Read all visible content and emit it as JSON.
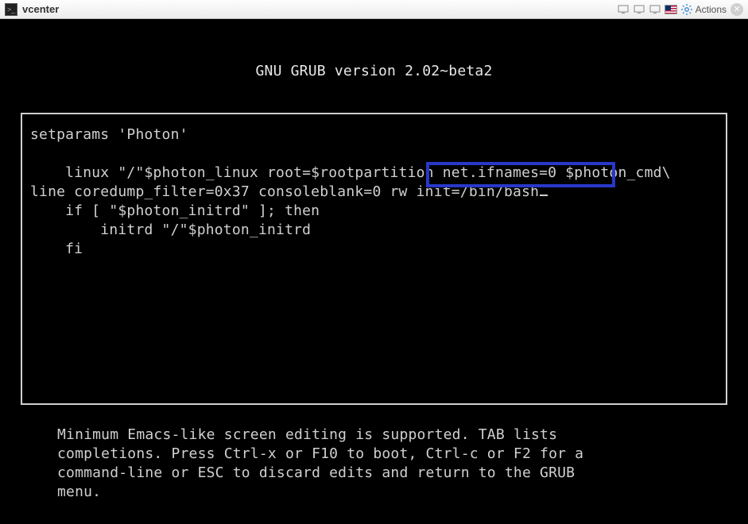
{
  "titlebar": {
    "title": "vcenter",
    "actions_label": "Actions"
  },
  "grub": {
    "header": "GNU GRUB  version 2.02~beta2",
    "lines": {
      "l0": "setparams 'Photon'",
      "l1": "",
      "l2": "    linux \"/\"$photon_linux root=$rootpartition net.ifnames=0 $photon_cmd\\",
      "l3_pre": "line coredump_filter=0x37 consoleblank=0 ",
      "l3_hl": "rw init=/bin/bash",
      "l4": "    if [ \"$photon_initrd\" ]; then",
      "l5": "        initrd \"/\"$photon_initrd",
      "l6": "    fi"
    },
    "help": "Minimum Emacs-like screen editing is supported. TAB lists\ncompletions. Press Ctrl-x or F10 to boot, Ctrl-c or F2 for a\ncommand-line or ESC to discard edits and return to the GRUB\nmenu."
  }
}
